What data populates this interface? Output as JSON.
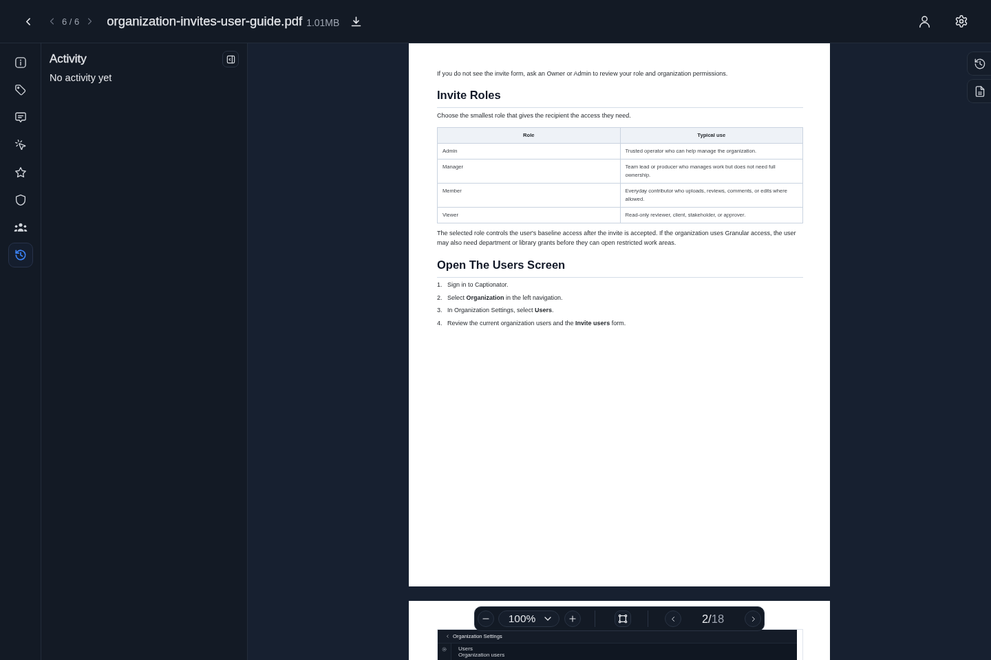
{
  "topbar": {
    "counter": "6 / 6",
    "file_name": "organization-invites-user-guide.pdf",
    "file_size": "1.01MB"
  },
  "rail": {
    "items": [
      {
        "kind": "info",
        "selected": false
      },
      {
        "kind": "tags",
        "selected": false
      },
      {
        "kind": "comments",
        "selected": false
      },
      {
        "kind": "actions",
        "selected": false
      },
      {
        "kind": "favorites",
        "selected": false
      },
      {
        "kind": "security",
        "selected": false
      },
      {
        "kind": "people",
        "selected": false
      },
      {
        "kind": "history",
        "selected": true
      }
    ]
  },
  "activity": {
    "title": "Activity",
    "empty_text": "No activity yet"
  },
  "document": {
    "pages": [
      {
        "blocks": [
          {
            "kind": "paragraph",
            "text": "If you do not see the invite form, ask an Owner or Admin to review your role and organization permissions."
          },
          {
            "kind": "heading",
            "text": "Invite Roles"
          },
          {
            "kind": "paragraph",
            "text": "Choose the smallest role that gives the recipient the access they need."
          },
          {
            "kind": "table",
            "columns": [
              "Role",
              "Typical use"
            ],
            "rows": [
              [
                "Admin",
                "Trusted operator who can help manage the organization."
              ],
              [
                "Manager",
                "Team lead or producer who manages work but does not need full ownership."
              ],
              [
                "Member",
                "Everyday contributor who uploads, reviews, comments, or edits where allowed."
              ],
              [
                "Viewer",
                "Read-only reviewer, client, stakeholder, or approver."
              ]
            ]
          },
          {
            "kind": "paragraph",
            "text": "The selected role controls the user's baseline access after the invite is accepted. If the organization uses Granular access, the user may also need department or library grants before they can open restricted work areas."
          },
          {
            "kind": "heading",
            "text": "Open The Users Screen"
          },
          {
            "kind": "list",
            "items": [
              {
                "number": "1.",
                "text": "Sign in to Captionator."
              },
              {
                "number": "2.",
                "text": "Select **Organization** in the left navigation."
              },
              {
                "number": "3.",
                "text": "In Organization Settings, select **Users**."
              },
              {
                "number": "4.",
                "text": "Review the current organization users and the **Invite users** form."
              }
            ]
          }
        ]
      },
      {
        "blocks": [
          {
            "kind": "screenshot",
            "title": "Organization Settings",
            "nav_item": "Users",
            "nav_subtitle": "Organization users"
          }
        ]
      }
    ]
  },
  "toolbar": {
    "zoom": "100%",
    "page": {
      "current": "2",
      "separator": "/",
      "total": "18"
    }
  },
  "side_tools": {
    "items": [
      {
        "kind": "history"
      },
      {
        "kind": "document"
      }
    ]
  }
}
